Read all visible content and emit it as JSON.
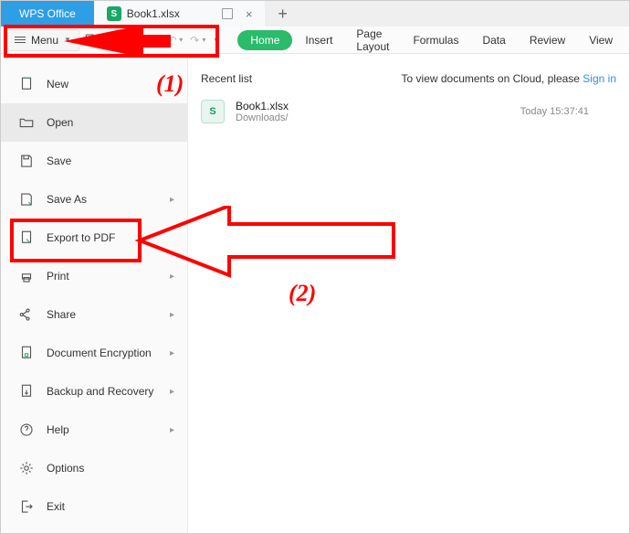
{
  "titlebar": {
    "app_name": "WPS Office",
    "doc_tab": "Book1.xlsx"
  },
  "toolbar": {
    "menu_label": "Menu"
  },
  "ribbon": {
    "home": "Home",
    "insert": "Insert",
    "page_layout": "Page Layout",
    "formulas": "Formulas",
    "data": "Data",
    "review": "Review",
    "view": "View"
  },
  "menu": {
    "new": "New",
    "open": "Open",
    "save": "Save",
    "save_as": "Save As",
    "export_pdf": "Export to PDF",
    "print": "Print",
    "share": "Share",
    "doc_enc": "Document Encryption",
    "backup": "Backup and Recovery",
    "help": "Help",
    "options": "Options",
    "exit": "Exit"
  },
  "content": {
    "recent_header": "Recent list",
    "cloud_msg": "To view documents on Cloud, please ",
    "signin": "Sign in",
    "file_name": "Book1.xlsx",
    "file_path": "Downloads/",
    "file_time": "Today 15:37:41"
  },
  "annotations": {
    "step1": "(1)",
    "step2": "(2)"
  }
}
